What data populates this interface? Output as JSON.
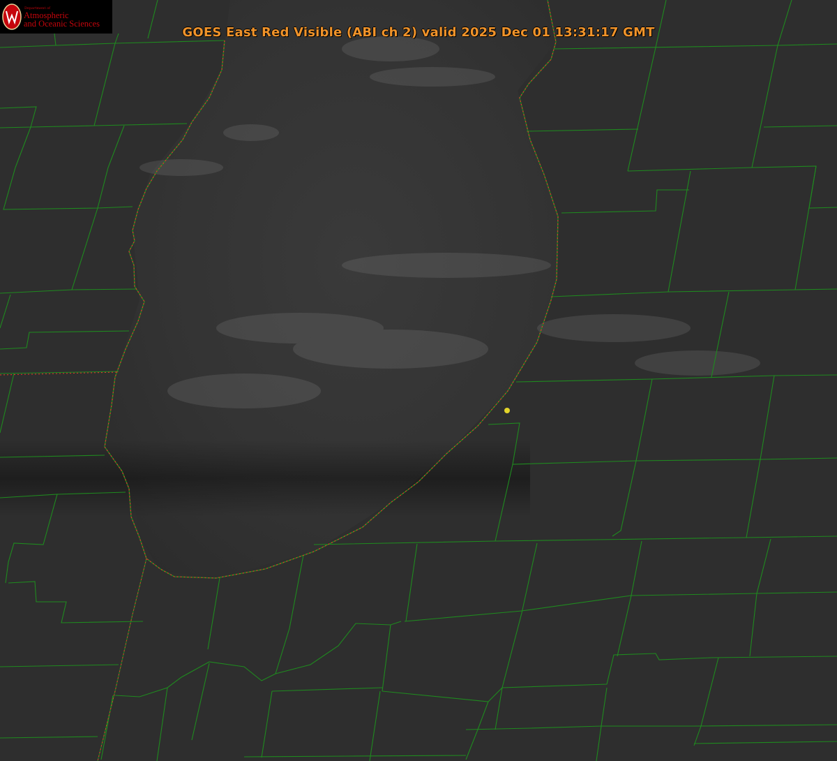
{
  "title": "GOES East Red Visible (ABI ch 2) valid 2025 Dec 01 13:31:17 GMT",
  "logo": {
    "seal_letter": "W",
    "department": "Department of",
    "line1": "Atmospheric",
    "line2": "and Oceanic Sciences"
  },
  "colors": {
    "title": "#f0932a",
    "county_borders": "#1f8a1f",
    "coastline": "#d83a2a",
    "marker": "#e2d42a",
    "logo_red": "#c5050c"
  }
}
